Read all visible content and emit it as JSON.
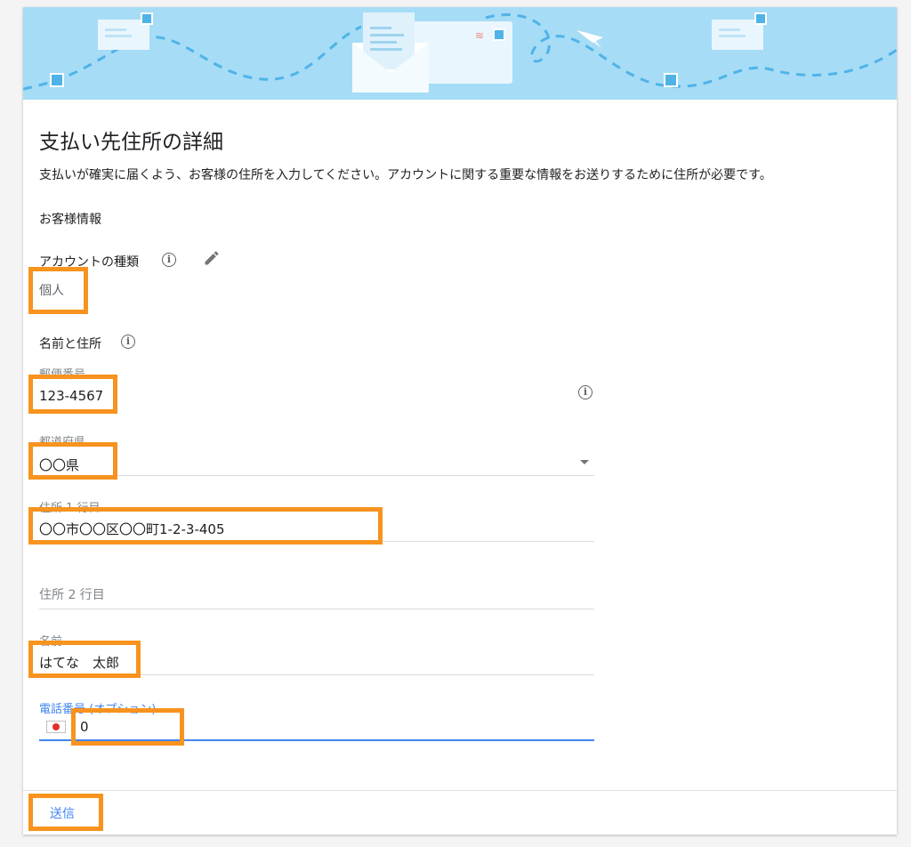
{
  "page": {
    "title": "支払い先住所の詳細",
    "description": "支払いが確実に届くよう、お客様の住所を入力してください。アカウントに関する重要な情報をお送りするために住所が必要です。"
  },
  "customer_info": {
    "heading": "お客様情報",
    "account_type": {
      "label": "アカウントの種類",
      "value": "個人"
    }
  },
  "name_address": {
    "heading": "名前と住所",
    "fields": {
      "postal_code": {
        "label": "郵便番号",
        "value": "123-4567"
      },
      "prefecture": {
        "label": "都道府県",
        "value": "〇〇県"
      },
      "address_line1": {
        "label": "住所 1 行目",
        "value": "〇〇市〇〇区〇〇町1-2-3-405"
      },
      "address_line2": {
        "placeholder": "住所 2 行目"
      },
      "name": {
        "label": "名前",
        "value": "はてな　太郎"
      },
      "phone": {
        "label": "電話番号 (オプション)",
        "value": "0",
        "country": "JP"
      }
    }
  },
  "footer": {
    "submit_label": "送信"
  },
  "colors": {
    "accent": "#4285f4",
    "highlight": "#f7931e",
    "banner": "#a6dcf6"
  }
}
